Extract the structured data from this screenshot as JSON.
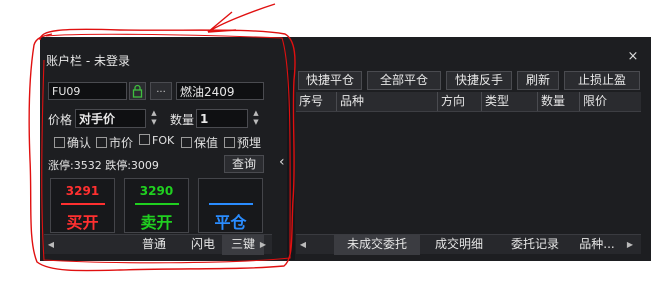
{
  "window": {
    "title": "账户栏  -  未登录",
    "close_glyph": "×"
  },
  "order_panel": {
    "contract_code": "FU09",
    "lock_icon": "lock-icon",
    "more_button": "...",
    "contract_name": "燃油2409",
    "price_label": "价格",
    "price_value": "对手价",
    "qty_label": "数量",
    "qty_value": "1",
    "checkboxes": [
      {
        "label": "确认",
        "checked": false
      },
      {
        "label": "市价",
        "checked": false
      },
      {
        "label": "FOK",
        "checked": false
      },
      {
        "label": "保值",
        "checked": false
      },
      {
        "label": "预埋",
        "checked": false
      }
    ],
    "limit_info": "涨停:3532 跌停:3009",
    "query_button": "查询",
    "collapse_glyph": "‹",
    "buy": {
      "price": "3291",
      "label": "买开",
      "color": "#ff3030"
    },
    "sell": {
      "price": "3290",
      "label": "卖开",
      "color": "#20d020"
    },
    "close": {
      "price": "",
      "label": "平仓",
      "color": "#2a8cff"
    },
    "tabs": [
      "普通",
      "闪电",
      "三键"
    ],
    "active_tab": "三键"
  },
  "positions_panel": {
    "toolbar": [
      "快捷平仓",
      "全部平仓",
      "快捷反手",
      "刷新",
      "止损止盈"
    ],
    "columns": [
      "序号",
      "品种",
      "方向",
      "类型",
      "数量",
      "限价"
    ],
    "tabs": [
      "未成交委托",
      "成交明细",
      "委托记录",
      "品种..."
    ],
    "active_tab": "未成交委托"
  },
  "colors": {
    "panel_bg": "#1d1e21",
    "annotation_red": "#e01010"
  }
}
